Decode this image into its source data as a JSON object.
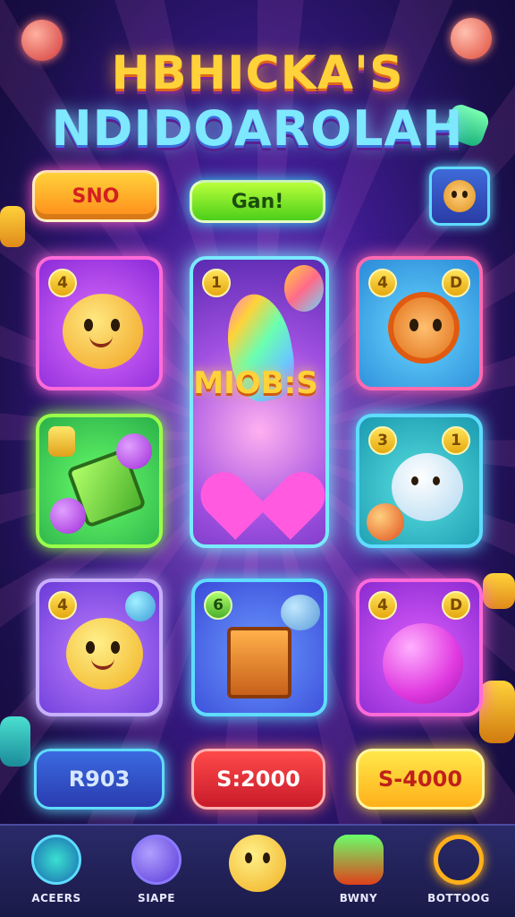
{
  "title": {
    "line1": "HBHICKA'S",
    "line2": "NDIDOAROLAH"
  },
  "top_buttons": {
    "left_label": "SNO",
    "center_label": "Gan!"
  },
  "grid": {
    "center_label": "MIOB:S",
    "tiles": [
      {
        "badge": "4"
      },
      {
        "badge": "1"
      },
      {
        "badge": "4",
        "badge2": "D"
      },
      {
        "badge": ""
      },
      {
        "badge": "3",
        "badge2": "1"
      },
      {
        "badge": "4"
      },
      {
        "badge": "6"
      },
      {
        "badge": "4",
        "badge2": "D"
      }
    ]
  },
  "prices": [
    "R903",
    "S:2000",
    "S-4000"
  ],
  "nav": [
    {
      "label": "ACEERS",
      "icon": "building-icon"
    },
    {
      "label": "SIAPE",
      "icon": "planet-icon"
    },
    {
      "label": "",
      "icon": "smiley-icon"
    },
    {
      "label": "BWNY",
      "icon": "veggie-icon"
    },
    {
      "label": "BOTTOOG",
      "icon": "ring-icon"
    }
  ],
  "colors": {
    "accent_pink": "#ff5fbf",
    "accent_cyan": "#5fdcff",
    "accent_yellow": "#ffd23a"
  }
}
